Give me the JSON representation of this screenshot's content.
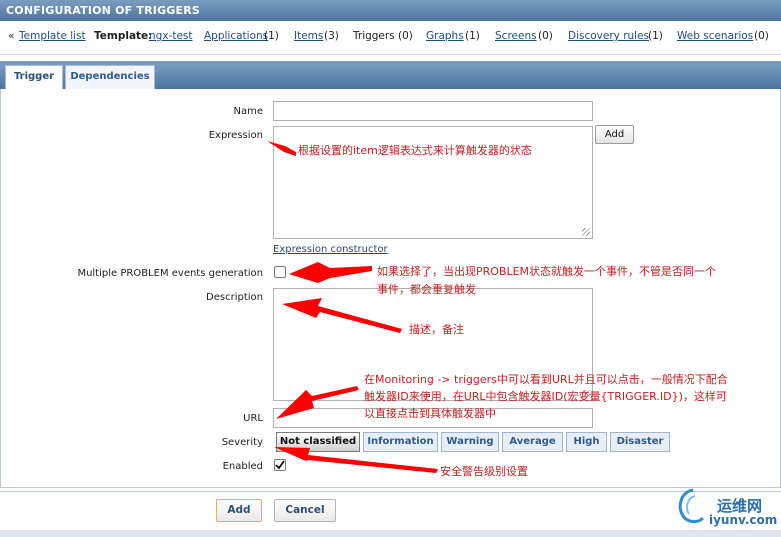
{
  "header": {
    "title": "CONFIGURATION OF TRIGGERS"
  },
  "nav": {
    "prefix": "«",
    "template_list": "Template list",
    "template_label": "Template:",
    "template_name": "ngx-test",
    "applications": "Applications",
    "applications_count": "(1)",
    "items": "Items",
    "items_count": "(3)",
    "triggers": "Triggers (0)",
    "graphs": "Graphs",
    "graphs_count": "(1)",
    "screens": "Screens",
    "screens_count": "(0)",
    "discovery": "Discovery rules",
    "discovery_count": "(1)",
    "web": "Web scenarios",
    "web_count": "(0)"
  },
  "tabs": {
    "trigger": "Trigger",
    "dependencies": "Dependencies"
  },
  "form": {
    "name_label": "Name",
    "name_value": "",
    "expression_label": "Expression",
    "expression_value": "",
    "add_expr_button": "Add",
    "expression_constructor": "Expression constructor",
    "multiple_label": "Multiple PROBLEM events generation",
    "multiple_checked": false,
    "description_label": "Description",
    "description_value": "",
    "url_label": "URL",
    "url_value": "",
    "severity_label": "Severity",
    "severity_options": [
      "Not classified",
      "Information",
      "Warning",
      "Average",
      "High",
      "Disaster"
    ],
    "severity_selected": "Not classified",
    "enabled_label": "Enabled",
    "enabled_checked": true
  },
  "footer": {
    "add": "Add",
    "cancel": "Cancel"
  },
  "annotations": {
    "expression": "根据设置的item逻辑表达式来计算触发器的状态",
    "multiple_line1": "如果选择了，当出现PROBLEM状态就触发一个事件，不管是否同一个",
    "multiple_line2": "事件，都会重复触发",
    "description": "描述，备注",
    "url_line1": "在Monitoring -> triggers中可以看到URL并且可以点击，一般情况下配合",
    "url_line2": "触发器ID来使用，在URL中包含触发器ID(宏变量{TRIGGER.ID})，这样可",
    "url_line3": "以直接点击到具体触发器中",
    "severity": "安全警告级别设置"
  },
  "watermark": {
    "cn": "运维网",
    "domain": "iyunv.com"
  },
  "colors": {
    "header": "#4f76a0",
    "link": "#1d4d83",
    "annotation": "#c82020",
    "arrow": "#ff0000"
  }
}
